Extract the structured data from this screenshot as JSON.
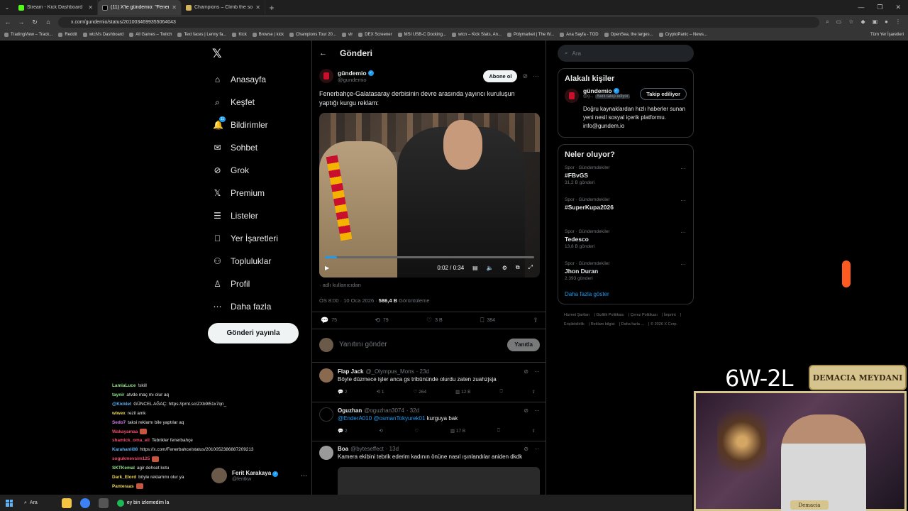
{
  "browser": {
    "tabs": [
      {
        "label": "Stream - Kick Dashboard",
        "color": "#53fc18",
        "active": false
      },
      {
        "label": "(11) X'te gündemio: \"Fenerbahçe...",
        "color": "#000000",
        "active": true
      },
      {
        "label": "Champions – Climb the solo qu...",
        "color": "#d4b35a",
        "active": false
      }
    ],
    "url": "x.com/gundemio/status/2010034699355064043",
    "bookmarks": [
      "TradingView – Track...",
      "Reddit",
      "wtcN's Dashboard",
      "All Games – Twitch",
      "Text faces | Lenny fa...",
      "Kick",
      "Browse | kick",
      "Champions Tour 20...",
      "vlr",
      "DEX Screener",
      "MSI USB-C Docking...",
      "wtcn – Kick Stats, An...",
      "Polymarket | The W...",
      "Ana Sayfa - TOD",
      "OpenSea, the larges...",
      "CryptoPanic – News..."
    ],
    "bookmarks_right": "Tüm Yer İşaretleri"
  },
  "nav": {
    "items": [
      {
        "icon": "home-icon",
        "glyph": "⌂",
        "label": "Anasayfa"
      },
      {
        "icon": "search-icon",
        "glyph": "⌕",
        "label": "Keşfet"
      },
      {
        "icon": "bell-icon",
        "glyph": "🔔",
        "label": "Bildirimler",
        "badge": "11"
      },
      {
        "icon": "mail-icon",
        "glyph": "✉",
        "label": "Sohbet"
      },
      {
        "icon": "grok-icon",
        "glyph": "⊘",
        "label": "Grok"
      },
      {
        "icon": "x-premium-icon",
        "glyph": "𝕏",
        "label": "Premium"
      },
      {
        "icon": "list-icon",
        "glyph": "☰",
        "label": "Listeler"
      },
      {
        "icon": "bookmark-icon",
        "glyph": "⎕",
        "label": "Yer İşaretleri"
      },
      {
        "icon": "communities-icon",
        "glyph": "⚇",
        "label": "Topluluklar"
      },
      {
        "icon": "profile-icon",
        "glyph": "♙",
        "label": "Profil"
      },
      {
        "icon": "more-circle-icon",
        "glyph": "⋯",
        "label": "Daha fazla"
      }
    ],
    "post_button": "Gönderi yayınla",
    "account": {
      "name": "Ferit Karakaya",
      "handle": "@feritkw"
    }
  },
  "chat": [
    {
      "user": "LamiaLuce",
      "color": "#8fe388",
      "msg": "!skill"
    },
    {
      "user": "taynir",
      "color": "#8fe388",
      "msg": "atvde maç mı olur aq"
    },
    {
      "user": "@Kicklet",
      "color": "#5db1f5",
      "msg": "GÜNCEL AĞAÇ: https://prnt.sc/ZXb9l51x7qn_"
    },
    {
      "user": "wiwex",
      "color": "#e8d35a",
      "msg": "rezil amk"
    },
    {
      "user": "Sedo7",
      "color": "#d97cf2",
      "msg": "taksi reklamı bile yaptılar aq"
    },
    {
      "user": "Wakayamaa",
      "color": "#f04a6b",
      "msg": "",
      "emote": true
    },
    {
      "user": "shamick_oma_eli",
      "color": "#f04a6b",
      "msg": "Tebrikler fenerbahçe"
    },
    {
      "user": "Karahanli08",
      "color": "#5db1f5",
      "msg": "https://x.com/Fenerbahce/status/2010052386887209213"
    },
    {
      "user": "sogukmevsim125",
      "color": "#f04a6b",
      "msg": "",
      "emote": true
    },
    {
      "user": "SKTKemal",
      "color": "#8fe388",
      "msg": "agir dehset kotu"
    },
    {
      "user": "Dark_Elord",
      "color": "#e8d35a",
      "msg": "böyle reklammı olur ya"
    },
    {
      "user": "Panteraas",
      "color": "#e8d35a",
      "msg": "",
      "emote": true
    }
  ],
  "post": {
    "header": "Gönderi",
    "author": {
      "name": "gündemio",
      "handle": "@gundemio"
    },
    "subscribe": "Abone ol",
    "text": "Fenerbahçe-Galatasaray derbisinin devre arasında yayıncı kuruluşun yaptığı kurgu reklam:",
    "video": {
      "current": "0:02",
      "duration": "0:34",
      "progress": 0.059
    },
    "source_note": "adlı kullanıcıdan",
    "timestamp": "ÖS 8:00 · 10 Oca 2026 · ",
    "views": "586,4 B",
    "views_label": " Görüntüleme",
    "actions": {
      "replies": "75",
      "reposts": "79",
      "likes": "3 B",
      "bookmarks": "384"
    },
    "reply_placeholder": "Yanıtını gönder",
    "reply_button": "Yanıtla"
  },
  "replies": [
    {
      "name": "Flap Jack",
      "handle": "@_Olympus_Mons",
      "time": "· 23d",
      "text": "Böyle düzmece işler anca gs tribününde olurdu zaten zuahzjsja",
      "mention": "",
      "replies": "2",
      "reposts": "1",
      "likes": "264",
      "views": "12 B",
      "avatar_color": "#8a6a4e"
    },
    {
      "name": "Oguzhan",
      "handle": "@oguzhan3074",
      "time": "· 32d",
      "text": " kurguya bak",
      "mention": "@EnderA010 @osmanTokyurek01",
      "replies": "2",
      "reposts": "",
      "likes": "",
      "views": "17 B",
      "avatar_color": "#000000"
    },
    {
      "name": "Boa",
      "handle": "@byteseffect",
      "time": "· 13d",
      "text": "Kamera ekibini tebrik ederim kadının önüne nasıl ışınlandılar aniden dkdk",
      "mention": "",
      "replies": "",
      "reposts": "",
      "likes": "",
      "views": "",
      "avatar_color": "#9a9a9a"
    }
  ],
  "sidebar": {
    "search_placeholder": "Ara",
    "related": {
      "title": "Alakalı kişiler",
      "name": "gündemio",
      "handle": "@g...",
      "tag": "Seni takip ediyor",
      "button": "Takip ediliyor",
      "bio": "Doğru kaynaklardan hızlı haberler sunan yeni nesil sosyal içerik platformu. info@gundem.io"
    },
    "trends_title": "Neler oluyor?",
    "trends": [
      {
        "category": "Spor · Gündemdekiler",
        "name": "#FBvGS",
        "posts": "31,2 B gönderi"
      },
      {
        "category": "Spor · Gündemdekiler",
        "name": "#SuperKupa2026",
        "posts": ""
      },
      {
        "category": "Spor · Gündemdekiler",
        "name": "Tedesco",
        "posts": "13,8 B gönderi"
      },
      {
        "category": "Spor · Gündemdekiler",
        "name": "Jhon Duran",
        "posts": "2.393 gönderi"
      }
    ],
    "show_more": "Daha fazla göster",
    "footer": [
      "Hizmet Şartları",
      "Gizlilik Politikası",
      "Çerez Politikası",
      "İmprint",
      "Erişilebilirlik",
      "Reklam bilgisi",
      "Daha fazla ...",
      "© 2026 X Corp."
    ]
  },
  "overlay": {
    "record": "6W-2L",
    "banner": "DEMACIA MEYDANI",
    "cam_tag": "Demacia"
  },
  "taskbar": {
    "search": "Ara",
    "spotify": "ey bin izlemedim la"
  }
}
